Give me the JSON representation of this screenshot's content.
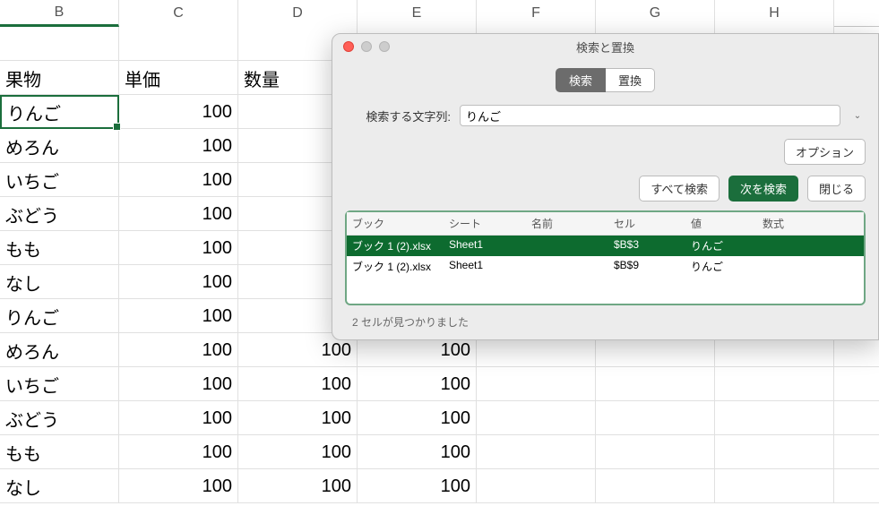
{
  "columns": [
    "B",
    "C",
    "D",
    "E",
    "F",
    "G",
    "H"
  ],
  "activeColumn": "B",
  "grid": {
    "rows": [
      {
        "B": "",
        "C": "",
        "D": "",
        "E": "",
        "F": "",
        "G": "",
        "H": ""
      },
      {
        "B": "果物",
        "C": "単価",
        "D": "数量",
        "E": "",
        "F": "",
        "G": "",
        "H": ""
      },
      {
        "B": "りんご",
        "C": "100",
        "D": "",
        "E": "",
        "F": "",
        "G": "",
        "H": "",
        "sel": true
      },
      {
        "B": "めろん",
        "C": "100",
        "D": "",
        "E": "",
        "F": "",
        "G": "",
        "H": ""
      },
      {
        "B": "いちご",
        "C": "100",
        "D": "",
        "E": "",
        "F": "",
        "G": "",
        "H": ""
      },
      {
        "B": "ぶどう",
        "C": "100",
        "D": "",
        "E": "",
        "F": "",
        "G": "",
        "H": ""
      },
      {
        "B": "もも",
        "C": "100",
        "D": "",
        "E": "",
        "F": "",
        "G": "",
        "H": ""
      },
      {
        "B": "なし",
        "C": "100",
        "D": "",
        "E": "",
        "F": "",
        "G": "",
        "H": ""
      },
      {
        "B": "りんご",
        "C": "100",
        "D": "",
        "E": "",
        "F": "",
        "G": "",
        "H": ""
      },
      {
        "B": "めろん",
        "C": "100",
        "D": "100",
        "E": "100",
        "F": "",
        "G": "",
        "H": ""
      },
      {
        "B": "いちご",
        "C": "100",
        "D": "100",
        "E": "100",
        "F": "",
        "G": "",
        "H": ""
      },
      {
        "B": "ぶどう",
        "C": "100",
        "D": "100",
        "E": "100",
        "F": "",
        "G": "",
        "H": ""
      },
      {
        "B": "もも",
        "C": "100",
        "D": "100",
        "E": "100",
        "F": "",
        "G": "",
        "H": ""
      },
      {
        "B": "なし",
        "C": "100",
        "D": "100",
        "E": "100",
        "F": "",
        "G": "",
        "H": ""
      }
    ]
  },
  "dialog": {
    "title": "検索と置換",
    "tabs": {
      "search": "検索",
      "replace": "置換",
      "active": "search"
    },
    "searchLabel": "検索する文字列:",
    "searchValue": "りんご",
    "optionsBtn": "オプション",
    "findAllBtn": "すべて検索",
    "findNextBtn": "次を検索",
    "closeBtn": "閉じる",
    "resultHeaders": {
      "book": "ブック",
      "sheet": "シート",
      "name": "名前",
      "cell": "セル",
      "value": "値",
      "formula": "数式"
    },
    "results": [
      {
        "book": "ブック 1 (2).xlsx",
        "sheet": "Sheet1",
        "name": "",
        "cell": "$B$3",
        "value": "りんご",
        "formula": "",
        "selected": true
      },
      {
        "book": "ブック 1 (2).xlsx",
        "sheet": "Sheet1",
        "name": "",
        "cell": "$B$9",
        "value": "りんご",
        "formula": "",
        "selected": false
      }
    ],
    "status": "2 セルが見つかりました"
  }
}
